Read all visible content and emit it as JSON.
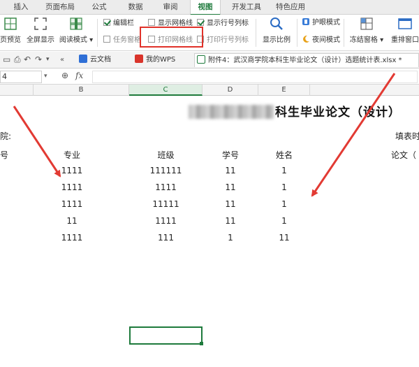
{
  "ribbon": {
    "tabs": [
      "插入",
      "页面布局",
      "公式",
      "数据",
      "审阅",
      "视图",
      "开发工具",
      "特色应用"
    ],
    "active_tab": "视图"
  },
  "toolbar": {
    "page_preview": "页预览",
    "full_screen": "全屏显示",
    "reading_mode": "阅读模式",
    "edit_bar": "编辑栏",
    "task_pane": "任务窗格",
    "show_gridlines": "显示网格线",
    "print_gridlines": "打印网格线",
    "show_row_col_headers": "显示行号列标",
    "print_row_col_headers": "打印行号列标",
    "zoom_label": "显示比例",
    "eye_protection": "护眼模式",
    "night_mode": "夜间模式",
    "freeze_panes": "冻结窗格",
    "rearrange_windows": "重排窗口",
    "states": {
      "edit_bar": true,
      "task_pane": false,
      "show_gridlines": false,
      "print_gridlines": false,
      "show_row_col_headers": true,
      "print_row_col_headers": false
    }
  },
  "doc_tabs": {
    "cloud_docs": "云文档",
    "my_wps": "我的WPS",
    "active_file": "附件4：武汉商学院本科生毕业论文（设计）选题统计表.xlsx *",
    "close_icon": "×"
  },
  "formula_bar": {
    "name_box": "4",
    "fx_label": "fx"
  },
  "columns": [
    "B",
    "C",
    "D",
    "E"
  ],
  "selected_column": "C",
  "sheet": {
    "title_suffix": "科生毕业论文（设计）",
    "left_label": "院:",
    "fill_label": "填表时",
    "headers": {
      "col_a": "号",
      "major": "专业",
      "class": "班级",
      "student_no": "学号",
      "name": "姓名",
      "thesis": "论文（"
    },
    "rows": [
      {
        "major": "1111",
        "class": "111111",
        "student_no": "11",
        "name": "1"
      },
      {
        "major": "1111",
        "class": "1111",
        "student_no": "11",
        "name": "1"
      },
      {
        "major": "1111",
        "class": "11111",
        "student_no": "11",
        "name": "1"
      },
      {
        "major": "11",
        "class": "1111",
        "student_no": "11",
        "name": "1"
      },
      {
        "major": "1111",
        "class": "111",
        "student_no": "1",
        "name": "11"
      }
    ]
  },
  "colors": {
    "accent_green": "#1e7a3c",
    "highlight_red": "#e0322a",
    "arrow_red": "#e23a33"
  }
}
